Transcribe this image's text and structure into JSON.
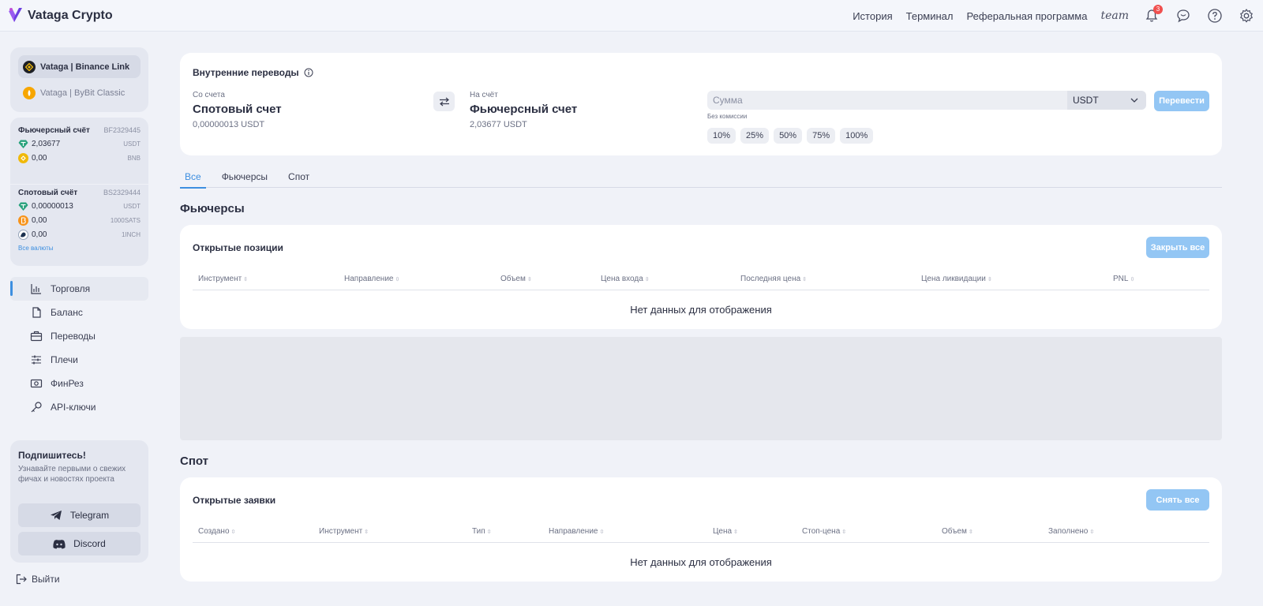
{
  "app": {
    "title": "Vataga Crypto",
    "brand_color": "#7a4ee8"
  },
  "header": {
    "links": [
      "История",
      "Терминал",
      "Реферальная программа"
    ],
    "team_label": "team",
    "notifications_count": "3",
    "icons": [
      "bell-icon",
      "chat-icon",
      "help-icon",
      "gear-icon"
    ]
  },
  "sidebar": {
    "accounts": [
      {
        "label": "Vataga | Binance Link",
        "active": true
      },
      {
        "label": "Vataga | ByBit Classic",
        "active": false
      }
    ],
    "futures": {
      "title": "Фьючерсный счёт",
      "id": "BF2329445",
      "rows": [
        {
          "amount": "2,03677",
          "currency": "USDT"
        },
        {
          "amount": "0,00",
          "currency": "BNB"
        }
      ]
    },
    "spot": {
      "title": "Спотовый счёт",
      "id": "BS2329444",
      "rows": [
        {
          "amount": "0,00000013",
          "currency": "USDT"
        },
        {
          "amount": "0,00",
          "currency": "1000SATS"
        },
        {
          "amount": "0,00",
          "currency": "1INCH"
        }
      ],
      "all_link": "Все валюты"
    },
    "menu": [
      {
        "label": "Торговля",
        "icon": "chart-icon",
        "active": true
      },
      {
        "label": "Баланс",
        "icon": "document-icon",
        "active": false
      },
      {
        "label": "Переводы",
        "icon": "briefcase-icon",
        "active": false
      },
      {
        "label": "Плечи",
        "icon": "sliders-icon",
        "active": false
      },
      {
        "label": "ФинРез",
        "icon": "cash-icon",
        "active": false
      },
      {
        "label": "API-ключи",
        "icon": "key-icon",
        "active": false
      }
    ],
    "subscribe": {
      "title": "Подпишитесь!",
      "desc": "Узнавайте первыми о свежих фичах и новостях проекта",
      "telegram": "Telegram",
      "discord": "Discord"
    },
    "logout": "Выйти"
  },
  "transfer": {
    "title": "Внутренние переводы",
    "from_label": "Со счета",
    "from_account": "Спотовый счет",
    "from_amount": "0,00000013 USDT",
    "to_label": "На счёт",
    "to_account": "Фьючерсный счет",
    "to_amount": "2,03677 USDT",
    "amount_placeholder": "Сумма",
    "currency": "USDT",
    "no_fee": "Без комиссии",
    "percents": [
      "10%",
      "25%",
      "50%",
      "75%",
      "100%"
    ],
    "button": "Перевести"
  },
  "tabs": [
    {
      "label": "Все",
      "active": true
    },
    {
      "label": "Фьючерсы",
      "active": false
    },
    {
      "label": "Спот",
      "active": false
    }
  ],
  "futures_section": {
    "title": "Фьючерсы",
    "card_title": "Открытые позиции",
    "button": "Закрыть все",
    "columns": [
      "Инструмент",
      "Направление",
      "Объем",
      "Цена входа",
      "Последняя цена",
      "Цена ликвидации",
      "PNL"
    ],
    "empty": "Нет данных для отображения"
  },
  "spot_section": {
    "title": "Спот",
    "card_title": "Открытые заявки",
    "button": "Снять все",
    "columns": [
      "Создано",
      "Инструмент",
      "Тип",
      "Направление",
      "Цена",
      "Стоп-цена",
      "Объем",
      "Заполнено"
    ],
    "empty": "Нет данных для отображения"
  }
}
